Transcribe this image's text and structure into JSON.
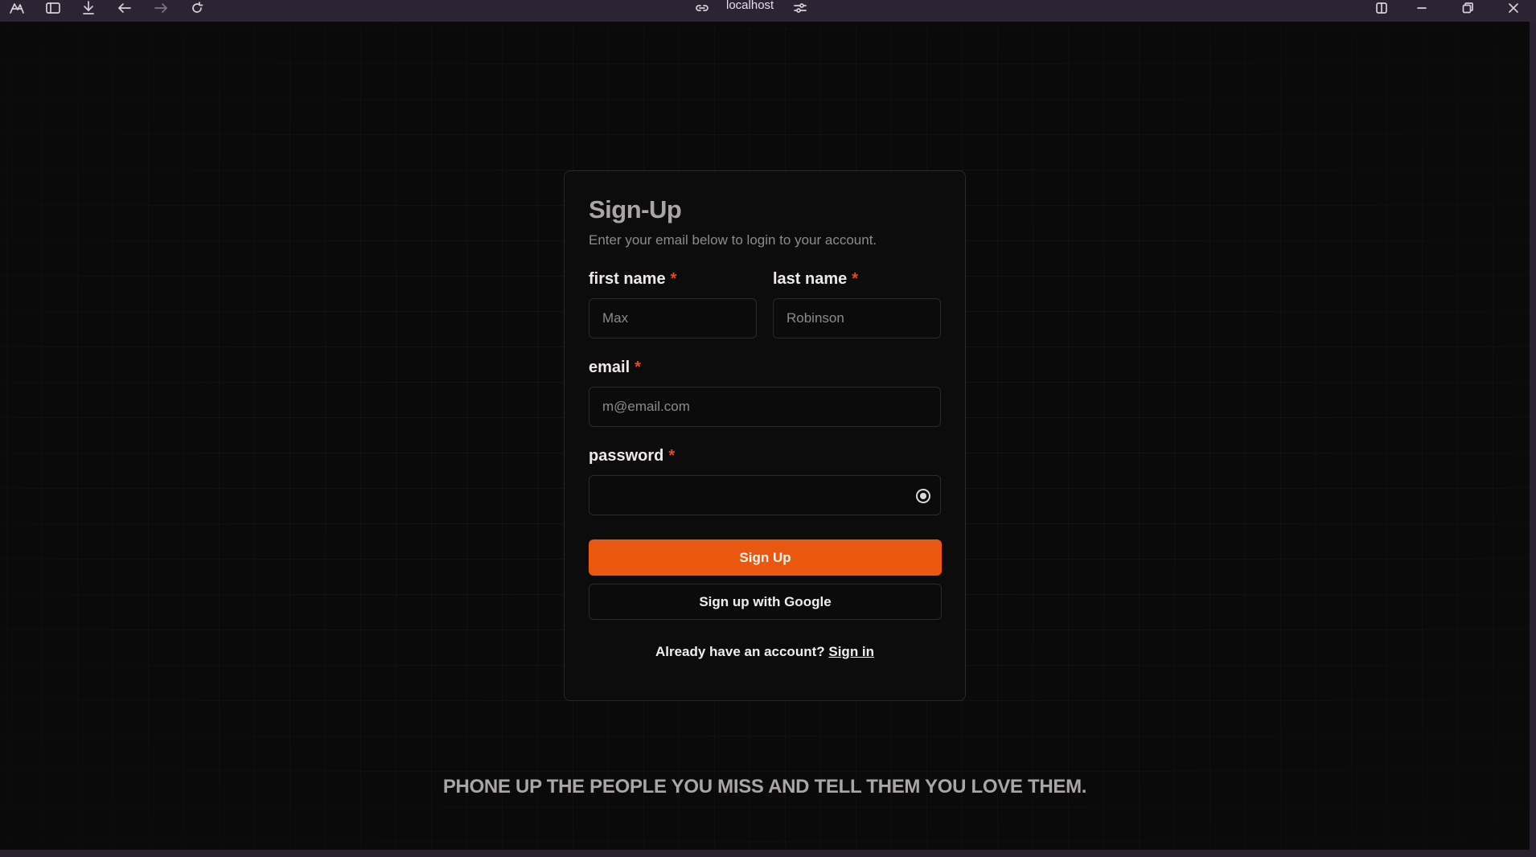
{
  "browser": {
    "url": "localhost",
    "icons": [
      "app-logo-icon",
      "sidebar-icon",
      "download-icon",
      "back-icon",
      "forward-icon",
      "reload-icon",
      "link-icon",
      "site-settings-icon",
      "split-view-icon",
      "minimize-icon",
      "restore-icon",
      "close-icon"
    ]
  },
  "form": {
    "title": "Sign-Up",
    "subtitle": "Enter your email below to login to your account.",
    "first_name": {
      "label": "first name",
      "required_mark": "*",
      "placeholder": "Max"
    },
    "last_name": {
      "label": "last name",
      "required_mark": "*",
      "placeholder": "Robinson"
    },
    "email": {
      "label": "email",
      "required_mark": "*",
      "placeholder": "m@email.com"
    },
    "password": {
      "label": "password",
      "required_mark": "*",
      "placeholder": ""
    },
    "submit_label": "Sign Up",
    "google_label": "Sign up with Google",
    "footer_text": "Already have an account?",
    "signin_link": "Sign in"
  },
  "tagline": "PHONE UP THE PEOPLE YOU MISS AND TELL THEM YOU LOVE THEM.",
  "colors": {
    "accent": "#ea570f",
    "required": "#e0492a",
    "background": "#0b0a0b"
  }
}
